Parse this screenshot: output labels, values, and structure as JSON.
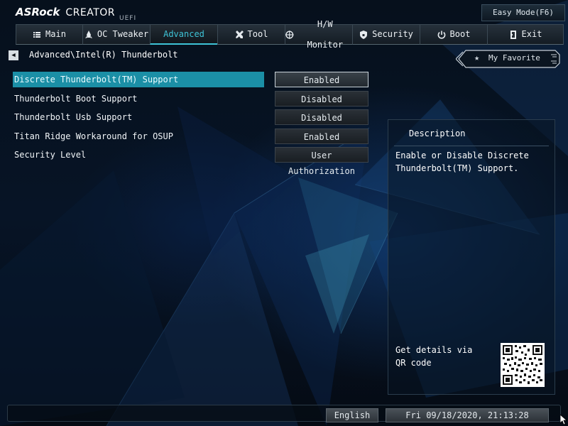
{
  "brand": {
    "name": "ASRock",
    "series": "CREATOR",
    "suffix": "UEFI"
  },
  "header": {
    "easy_mode_label": "Easy Mode(F6)"
  },
  "tabs": [
    {
      "label": "Main",
      "icon": "list-icon",
      "active": false
    },
    {
      "label": "OC Tweaker",
      "icon": "rocket-icon",
      "active": false
    },
    {
      "label": "Advanced",
      "icon": "",
      "active": true
    },
    {
      "label": "Tool",
      "icon": "tools-icon",
      "active": false
    },
    {
      "label": "H/W Monitor",
      "icon": "crosshair-icon",
      "active": false
    },
    {
      "label": "Security",
      "icon": "shield-icon",
      "active": false
    },
    {
      "label": "Boot",
      "icon": "power-icon",
      "active": false
    },
    {
      "label": "Exit",
      "icon": "exit-door-icon",
      "active": false
    }
  ],
  "breadcrumb": "Advanced\\Intel(R) Thunderbolt",
  "favorite": {
    "label": "My Favorite",
    "icon": "star-icon"
  },
  "settings": [
    {
      "label": "Discrete Thunderbolt(TM) Support",
      "value": "Enabled",
      "selected": true
    },
    {
      "label": "Thunderbolt Boot Support",
      "value": "Disabled",
      "selected": false
    },
    {
      "label": "Thunderbolt Usb Support",
      "value": "Disabled",
      "selected": false
    },
    {
      "label": "Titan Ridge Workaround for OSUP",
      "value": "Enabled",
      "selected": false
    },
    {
      "label": "Security Level",
      "value": "User Authorization",
      "selected": false
    }
  ],
  "description": {
    "title": "Description",
    "text": "Enable or Disable Discrete\nThunderbolt(TM) Support.",
    "qr_text": "Get details via QR code"
  },
  "footer": {
    "language": "English",
    "datetime": "Fri 09/18/2020, 21:13:28"
  },
  "colors": {
    "accent": "#3ec3d6",
    "selected_row": "#1b8fa6",
    "background": "#071426"
  }
}
